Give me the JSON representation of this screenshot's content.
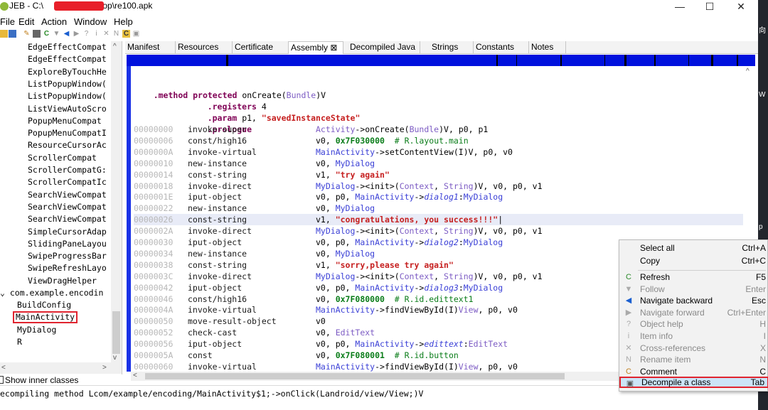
{
  "window": {
    "title_prefix": "JEB - C:\\",
    "title_suffix": "ctop\\re100.apk",
    "minimize": "—",
    "maximize": "☐",
    "close": "✕"
  },
  "right_edge": {
    "a": "向",
    "b": "W",
    "c": "p"
  },
  "menu": [
    "File",
    "Edit",
    "Action",
    "Window",
    "Help"
  ],
  "toolbar_icons": [
    "open-icon",
    "save-icon",
    "wrench-icon",
    "lock-icon",
    "refresh-icon",
    "filter-icon",
    "back-icon",
    "forward-icon",
    "help-icon",
    "info-icon",
    "xref-icon",
    "rename-icon",
    "comment-icon",
    "decompile-icon"
  ],
  "tree": {
    "items": [
      "EdgeEffectCompat",
      "EdgeEffectCompat",
      "ExploreByTouchHe",
      "ListPopupWindow(",
      "ListPopupWindow(",
      "ListViewAutoScro",
      "PopupMenuCompat",
      "PopupMenuCompatI",
      "ResourceCursorAc",
      "ScrollerCompat",
      "ScrollerCompatG:",
      "ScrollerCompatIc",
      "SearchViewCompat",
      "SearchViewCompat",
      "SearchViewCompat",
      "SimpleCursorAdap",
      "SlidingPaneLayou",
      "SwipeProgressBar",
      "SwipeRefreshLayo",
      "ViewDragHelper"
    ],
    "package": "com.example.encodin",
    "package_children": [
      "BuildConfig",
      "MainActivity",
      "MyDialog",
      "R"
    ],
    "show_inner": "Show inner classes"
  },
  "tabs": [
    "Manifest",
    "Resources",
    "Certificate",
    "Assembly ⊠",
    "Decompiled Java",
    "Strings",
    "Constants",
    "Notes"
  ],
  "code": {
    "method_kw": ".method",
    "method_mod": "protected",
    "method_name": "onCreate(",
    "method_param": "Bundle",
    "method_ret": ")V",
    "registers_kw": ".registers",
    "registers_val": "4",
    "param_kw": ".param",
    "param_reg": "p1, ",
    "param_str": "\"savedInstanceState\"",
    "prologue_kw": ".prologue",
    "lines": [
      {
        "addr": "00000000",
        "op": "invoke-super"
      },
      {
        "addr": "00000006",
        "op": "const/high16"
      },
      {
        "addr": "0000000A",
        "op": "invoke-virtual"
      },
      {
        "addr": "00000010",
        "op": "new-instance"
      },
      {
        "addr": "00000014",
        "op": "const-string"
      },
      {
        "addr": "00000018",
        "op": "invoke-direct"
      },
      {
        "addr": "0000001E",
        "op": "iput-object"
      },
      {
        "addr": "00000022",
        "op": "new-instance"
      },
      {
        "addr": "00000026",
        "op": "const-string"
      },
      {
        "addr": "0000002A",
        "op": "invoke-direct"
      },
      {
        "addr": "00000030",
        "op": "iput-object"
      },
      {
        "addr": "00000034",
        "op": "new-instance"
      },
      {
        "addr": "00000038",
        "op": "const-string"
      },
      {
        "addr": "0000003C",
        "op": "invoke-direct"
      },
      {
        "addr": "00000042",
        "op": "iput-object"
      },
      {
        "addr": "00000046",
        "op": "const/high16"
      },
      {
        "addr": "0000004A",
        "op": "invoke-virtual"
      },
      {
        "addr": "00000050",
        "op": "move-result-object"
      },
      {
        "addr": "00000052",
        "op": "check-cast"
      },
      {
        "addr": "00000056",
        "op": "iput-object"
      },
      {
        "addr": "0000005A",
        "op": "const"
      },
      {
        "addr": "00000060",
        "op": "invoke-virtual"
      }
    ],
    "a0": [
      "Activity",
      "->onCreate(",
      "Bundle",
      ")V, p0, p1"
    ],
    "a1": [
      "v0, ",
      "0x7F030000",
      "  # R.layout.main"
    ],
    "a2": [
      "MainActivity",
      "->setContentView(I)V, p0, v0"
    ],
    "a3": [
      "v0, ",
      "MyDialog"
    ],
    "a4": [
      "v1, ",
      "\"try again\""
    ],
    "a5": [
      "MyDialog",
      "-><init>(",
      "Context",
      ", ",
      "String",
      ")V, v0, p0, v1"
    ],
    "a6": [
      "v0, p0, ",
      "MainActivity",
      "->",
      "dialog1",
      ":",
      "MyDialog"
    ],
    "a7": [
      "v0, ",
      "MyDialog"
    ],
    "a8": [
      "v1, ",
      "\"congratulations, you success!!!\""
    ],
    "a9": [
      "MyDialog",
      "-><init>(",
      "Context",
      ", ",
      "String",
      ")V, v0, p0, v1"
    ],
    "a10": [
      "v0, p0, ",
      "MainActivity",
      "->",
      "dialog2",
      ":",
      "MyDialog"
    ],
    "a11": [
      "v0, ",
      "MyDialog"
    ],
    "a12": [
      "v1, ",
      "\"sorry,please try again\""
    ],
    "a13": [
      "MyDialog",
      "-><init>(",
      "Context",
      ", ",
      "String",
      ")V, v0, p0, v1"
    ],
    "a14": [
      "v0, p0, ",
      "MainActivity",
      "->",
      "dialog3",
      ":",
      "MyDialog"
    ],
    "a15": [
      "v0, ",
      "0x7F080000",
      "  # R.id.edittext1"
    ],
    "a16": [
      "MainActivity",
      "->findViewById(I)",
      "View",
      ", p0, v0"
    ],
    "a17": [
      "v0"
    ],
    "a18": [
      "v0, ",
      "EditText"
    ],
    "a19": [
      "v0, p0, ",
      "MainActivity",
      "->",
      "edittext",
      ":",
      "EditText"
    ],
    "a20": [
      "v0, ",
      "0x7F080001",
      "  # R.id.button"
    ],
    "a21": [
      "MainActivity",
      "->findViewById(I)",
      "View",
      ", p0, v0"
    ]
  },
  "status": "ecompiling method Lcom/example/encoding/MainActivity$1;->onClick(Landroid/view/View;)V",
  "context_menu": [
    {
      "icon": "",
      "label": "Select all",
      "key": "Ctrl+A",
      "enabled": true
    },
    {
      "icon": "",
      "label": "Copy",
      "key": "Ctrl+C",
      "enabled": true
    },
    {
      "icon": "C",
      "label": "Refresh",
      "key": "F5",
      "enabled": true
    },
    {
      "icon": "▼",
      "label": "Follow",
      "key": "Enter",
      "enabled": false
    },
    {
      "icon": "◀",
      "label": "Navigate backward",
      "key": "Esc",
      "enabled": true
    },
    {
      "icon": "▶",
      "label": "Navigate forward",
      "key": "Ctrl+Enter",
      "enabled": false
    },
    {
      "icon": "?",
      "label": "Object help",
      "key": "H",
      "enabled": false
    },
    {
      "icon": "i",
      "label": "Item info",
      "key": "I",
      "enabled": false
    },
    {
      "icon": "✕",
      "label": "Cross-references",
      "key": "X",
      "enabled": false
    },
    {
      "icon": "N",
      "label": "Rename item",
      "key": "N",
      "enabled": false
    },
    {
      "icon": "C",
      "label": "Comment",
      "key": "C",
      "enabled": true
    },
    {
      "icon": "▣",
      "label": "Decompile a class",
      "key": "Tab",
      "enabled": true
    }
  ],
  "colors": {
    "overview": "#0011dd",
    "selection_outline": "#e0242f",
    "menu_hot": "#cce4f7"
  }
}
